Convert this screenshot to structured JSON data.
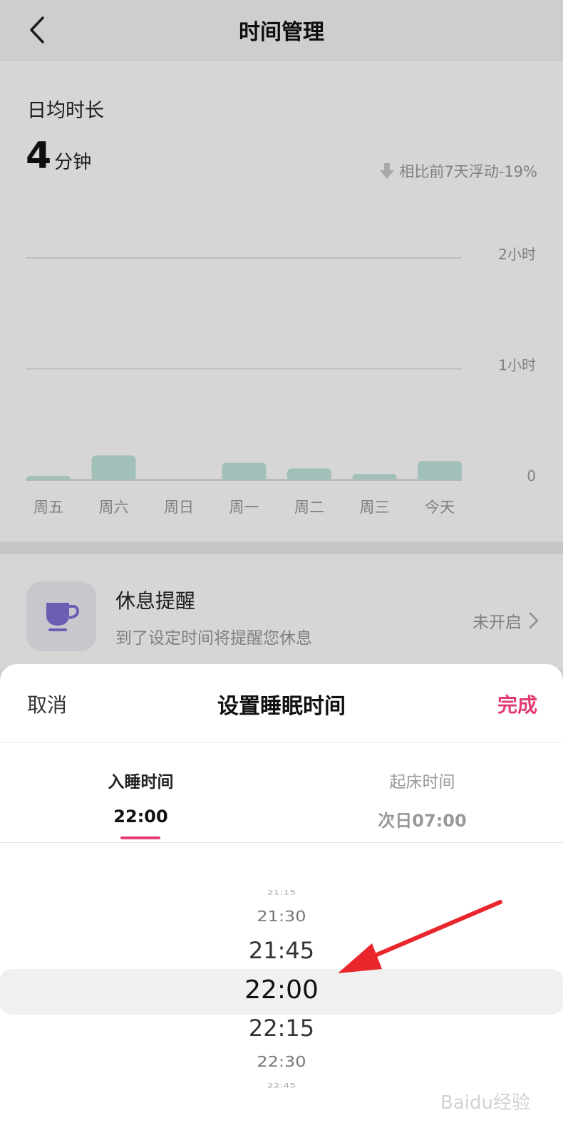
{
  "nav": {
    "title": "时间管理"
  },
  "stats": {
    "avg_label": "日均时长",
    "avg_number": "4",
    "avg_unit": "分钟",
    "compare_text": "相比前7天浮动-19%"
  },
  "chart_data": {
    "type": "bar",
    "categories": [
      "周五",
      "周六",
      "周日",
      "周一",
      "周二",
      "周三",
      "今天"
    ],
    "values": [
      2,
      13,
      0,
      9,
      6,
      3,
      10
    ],
    "ylim": [
      0,
      120
    ],
    "y_ticks": [
      {
        "value": 120,
        "label": "2小时"
      },
      {
        "value": 60,
        "label": "1小时"
      },
      {
        "value": 0,
        "label": "0"
      }
    ],
    "grid": true,
    "bar_color": "#bfe5dd"
  },
  "rest": {
    "title": "休息提醒",
    "description": "到了设定时间将提醒您休息",
    "status": "未开启",
    "icon": "cup-icon"
  },
  "sheet": {
    "cancel_label": "取消",
    "title": "设置睡眠时间",
    "done_label": "完成",
    "tabs": [
      {
        "label": "入睡时间",
        "time": "22:00"
      },
      {
        "label": "起床时间",
        "time": "次日07:00"
      }
    ],
    "picker": [
      "21:15",
      "21:30",
      "21:45",
      "22:00",
      "22:15",
      "22:30",
      "22:45"
    ]
  },
  "watermark": "Baidu经验",
  "colors": {
    "accent": "#e23c71",
    "cup": "#7f6fd6",
    "arrow": "#e8262c"
  }
}
